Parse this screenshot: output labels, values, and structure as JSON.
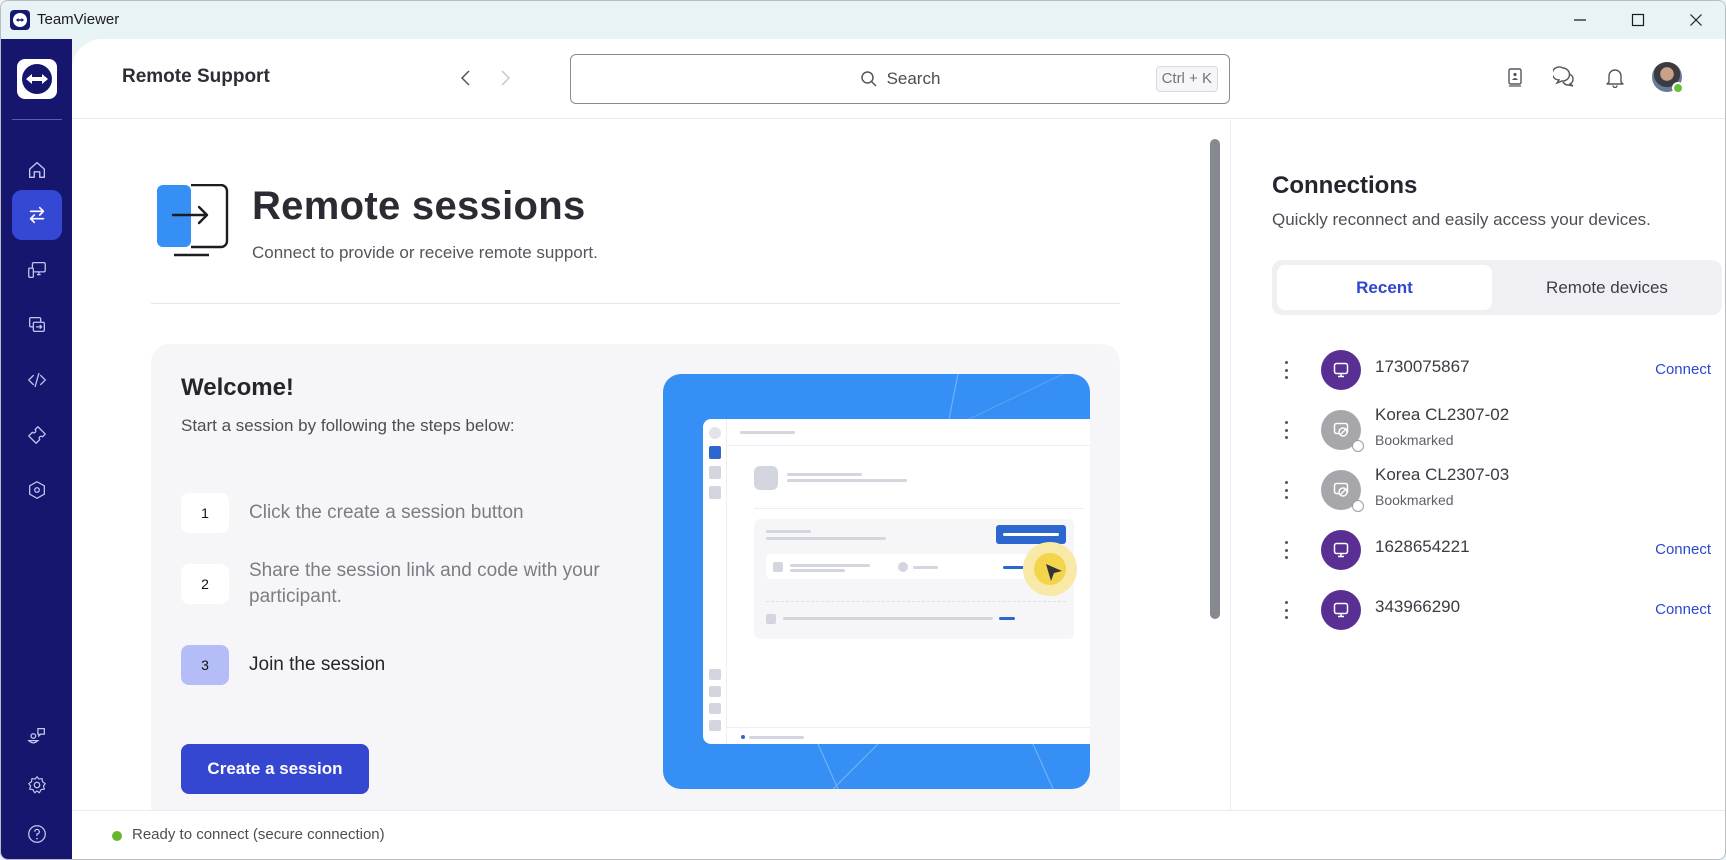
{
  "window": {
    "title": "TeamViewer",
    "controls": [
      "minimize",
      "maximize",
      "close"
    ]
  },
  "sidebar": {
    "items": [
      {
        "id": "home",
        "icon": "home-icon",
        "active": false
      },
      {
        "id": "remote-support",
        "icon": "swap-arrows-icon",
        "active": true
      },
      {
        "id": "devices",
        "icon": "devices-icon",
        "active": false
      },
      {
        "id": "remote-access",
        "icon": "screen-share-icon",
        "active": false
      },
      {
        "id": "developer",
        "icon": "code-icon",
        "active": false
      },
      {
        "id": "tickets",
        "icon": "ticket-icon",
        "active": false
      },
      {
        "id": "device-management",
        "icon": "hex-refresh-icon",
        "active": false
      }
    ],
    "bottom_items": [
      {
        "id": "community",
        "icon": "community-icon"
      },
      {
        "id": "settings",
        "icon": "gear-icon"
      },
      {
        "id": "help",
        "icon": "help-icon"
      }
    ]
  },
  "header": {
    "title": "Remote Support",
    "search": {
      "placeholder": "Search",
      "shortcut": "Ctrl + K"
    },
    "icons": [
      "contacts-book-icon",
      "chat-icon",
      "bell-icon"
    ],
    "user_status": "online"
  },
  "main": {
    "title": "Remote sessions",
    "subtitle": "Connect to provide or receive remote support.",
    "welcome": {
      "heading": "Welcome!",
      "subheading": "Start a session by following the steps below:",
      "steps": [
        {
          "num": "1",
          "text": "Click the create a session button",
          "active": false
        },
        {
          "num": "2",
          "text": "Share the session link and code with your participant.",
          "active": false
        },
        {
          "num": "3",
          "text": "Join the session",
          "active": true
        }
      ],
      "button_label": "Create a session"
    }
  },
  "connections": {
    "title": "Connections",
    "subtitle": "Quickly reconnect and easily access your devices.",
    "tabs": [
      {
        "label": "Recent",
        "active": true
      },
      {
        "label": "Remote devices",
        "active": false
      }
    ],
    "items": [
      {
        "name": "1730075867",
        "sub": "",
        "status": "online",
        "action": "Connect"
      },
      {
        "name": "Korea CL2307-02",
        "sub": "Bookmarked",
        "status": "offline",
        "action": ""
      },
      {
        "name": "Korea CL2307-03",
        "sub": "Bookmarked",
        "status": "offline",
        "action": ""
      },
      {
        "name": "1628654221",
        "sub": "",
        "status": "online",
        "action": "Connect"
      },
      {
        "name": "343966290",
        "sub": "",
        "status": "online",
        "action": "Connect"
      }
    ]
  },
  "status_bar": {
    "text": "Ready to connect (secure connection)",
    "state_color": "#6ab52e"
  },
  "colors": {
    "sidebar_bg": "#17166e",
    "accent": "#3546d1",
    "link": "#2d47cd",
    "device_online": "#5a2f93",
    "illustration_bg": "#368ff4"
  }
}
